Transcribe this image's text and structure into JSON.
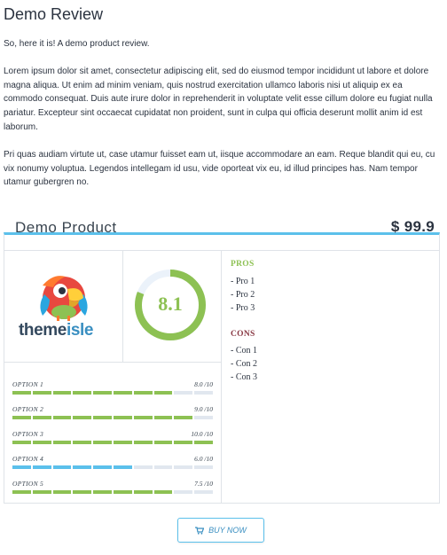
{
  "article": {
    "title": "Demo Review",
    "intro": "So, here it is! A demo product review.",
    "paragraph1": "Lorem ipsum dolor sit amet, consectetur adipiscing elit, sed do eiusmod tempor incididunt ut labore et dolore magna aliqua. Ut enim ad minim veniam, quis nostrud exercitation ullamco laboris nisi ut aliquip ex ea commodo consequat. Duis aute irure dolor in reprehenderit in voluptate velit esse cillum dolore eu fugiat nulla pariatur. Excepteur sint occaecat cupidatat non proident, sunt in culpa qui officia deserunt mollit anim id est laborum.",
    "paragraph2": "Pri quas audiam virtute ut, case utamur fuisset eam ut, iisque accommodare an eam. Reque blandit qui eu, cu vix nonumy voluptua. Legendos intellegam id usu, vide oporteat vix eu, id illud principes has. Nam tempor utamur gubergren no."
  },
  "review": {
    "product_name": "Demo Product",
    "price": "$ 99.9",
    "logo": {
      "icon": "parrot-logo",
      "text_a": "theme",
      "text_b": "isle"
    },
    "score": {
      "value": "8.1",
      "fraction": 0.81,
      "color": "#8dc153",
      "track_color": "#ebf2fa"
    },
    "pros_title": "PROS",
    "pros": [
      "- Pro 1",
      "- Pro 2",
      "- Pro 3"
    ],
    "cons_title": "CONS",
    "cons": [
      "- Con 1",
      "- Con 2",
      "- Con 3"
    ],
    "options": [
      {
        "label": "OPTION 1",
        "score": "8.0 /10",
        "value": 8.0,
        "color": "#8dc153"
      },
      {
        "label": "OPTION 2",
        "score": "9.0 /10",
        "value": 9.0,
        "color": "#8dc153"
      },
      {
        "label": "OPTION 3",
        "score": "10.0 /10",
        "value": 10.0,
        "color": "#8dc153"
      },
      {
        "label": "OPTION 4",
        "score": "6.0 /10",
        "value": 6.0,
        "color": "#5bc0eb"
      },
      {
        "label": "OPTION 5",
        "score": "7.5 /10",
        "value": 7.5,
        "color": "#8dc153"
      }
    ],
    "segment_empty_color": "#e1e7ef",
    "buy_label": "BUY NOW",
    "buy_icon": "cart-icon",
    "accent": "#5bc0eb"
  }
}
